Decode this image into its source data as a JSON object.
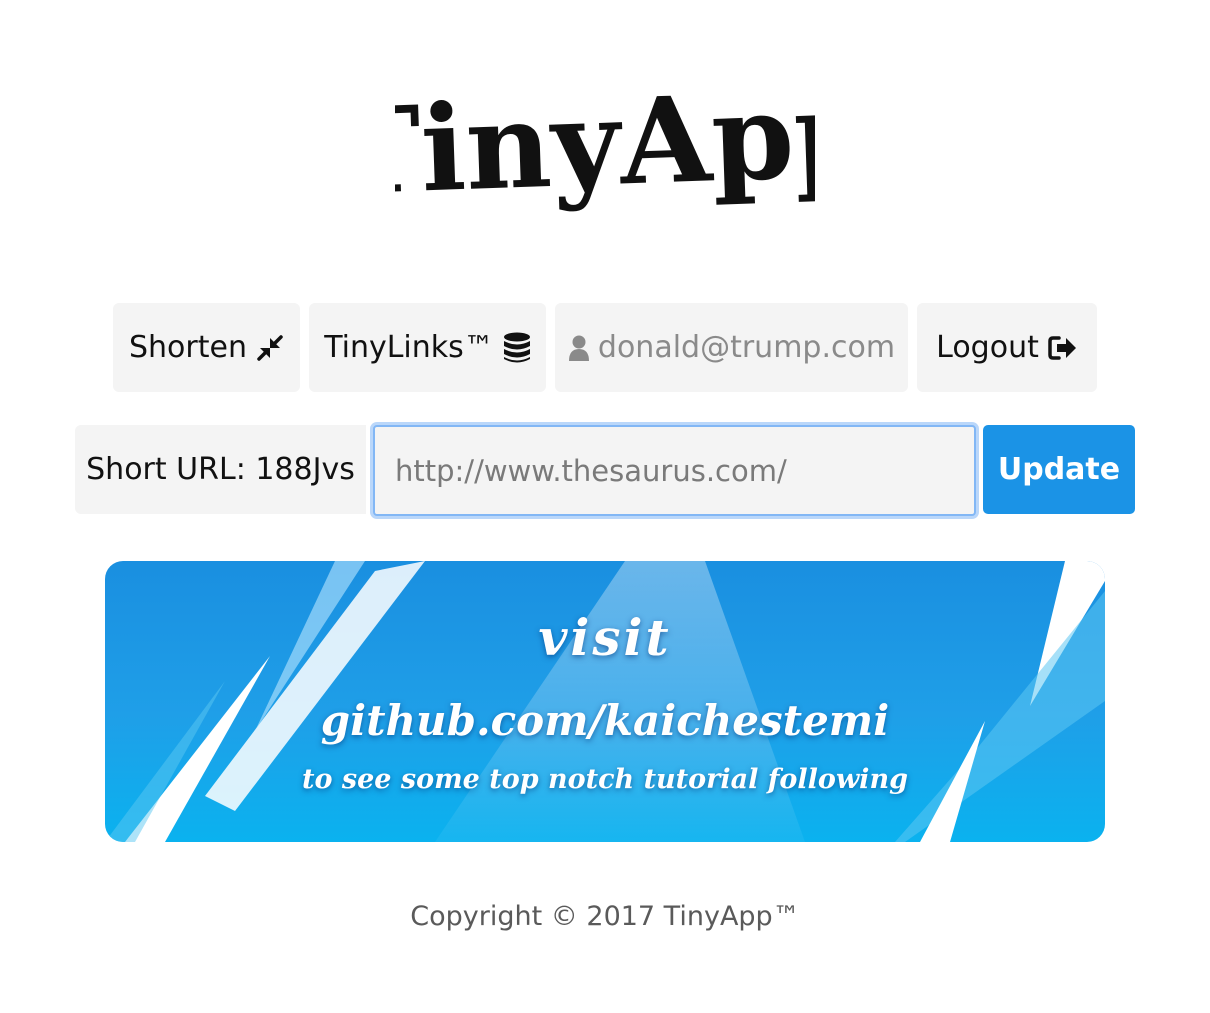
{
  "logo": {
    "text": "TinyApp"
  },
  "nav": {
    "shorten_label": "Shorten",
    "tinylinks_label": "TinyLinks™",
    "user_email": "donald@trump.com",
    "logout_label": "Logout"
  },
  "form": {
    "short_url_label": "Short URL: 188Jvs",
    "long_url_value": "http://www.thesaurus.com/",
    "submit_label": "Update"
  },
  "banner": {
    "line1": "visit",
    "line2": "github.com/kaichestemi",
    "line3": "to see some top notch tutorial following"
  },
  "footer": {
    "copyright": "Copyright © 2017 TinyApp™"
  },
  "icons": {
    "shorten": "compress-arrows-icon",
    "tinylinks": "database-icon",
    "user": "user-icon",
    "logout": "sign-out-icon"
  },
  "colors": {
    "accent": "#1b93e6",
    "nav_bg": "#f4f4f4",
    "focus_ring": "#82b7f5",
    "banner": "#1a8fe0"
  }
}
